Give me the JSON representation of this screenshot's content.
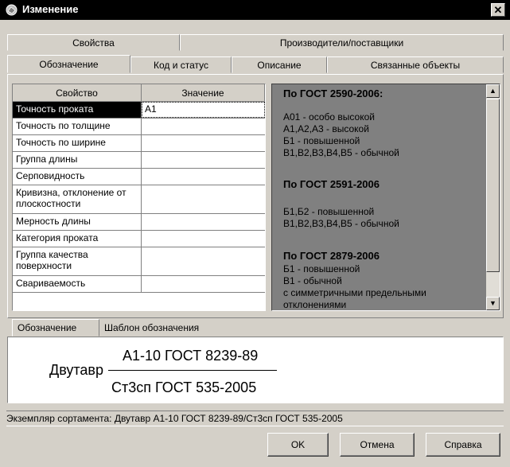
{
  "window": {
    "title": "Изменение",
    "close_glyph": "✕"
  },
  "tabs_row1": [
    "Свойства",
    "Производители/поставщики"
  ],
  "tabs_row2": [
    "Обозначение",
    "Код и статус",
    "Описание",
    "Связанные объекты"
  ],
  "table": {
    "headers": [
      "Свойство",
      "Значение"
    ],
    "rows": [
      {
        "name": "Точность проката",
        "value": "А1"
      },
      {
        "name": "Точность по толщине",
        "value": ""
      },
      {
        "name": "Точность по ширине",
        "value": ""
      },
      {
        "name": "Группа длины",
        "value": ""
      },
      {
        "name": "Серповидность",
        "value": ""
      },
      {
        "name": "Кривизна, отклонение от плоскостности",
        "value": ""
      },
      {
        "name": "Мерность длины",
        "value": ""
      },
      {
        "name": "Категория проката",
        "value": ""
      },
      {
        "name": "Группа качества поверхности",
        "value": ""
      },
      {
        "name": "Свариваемость",
        "value": ""
      }
    ]
  },
  "description": {
    "h1": "По ГОСТ 2590-2006:",
    "l1": "А01 - особо высокой",
    "l2": "А1,А2,А3 - высокой",
    "l3": "Б1 - повышенной",
    "l4": "В1,В2,В3,В4,В5 - обычной",
    "h2": "По ГОСТ 2591-2006",
    "l5": "Б1,Б2 - повышенной",
    "l6": "В1,В2,В3,В4,В5 - обычной",
    "h3": "По ГОСТ 2879-2006",
    "l7": "Б1 - повышенной",
    "l8": "В1 - обычной",
    "l9": "с симметричными предельными",
    "l10": "отклонениями"
  },
  "lower_tabs": [
    "Обозначение",
    "Шаблон обозначения"
  ],
  "designation": {
    "main": "Двутавр",
    "numerator": "А1-10 ГОСТ 8239-89",
    "denominator": "Ст3сп ГОСТ 535-2005"
  },
  "instance_text": "Экземпляр сортамента: Двутавр А1-10 ГОСТ 8239-89/Ст3сп ГОСТ 535-2005",
  "buttons": {
    "ok": "OK",
    "cancel": "Отмена",
    "help": "Справка"
  },
  "scroll": {
    "up": "▲",
    "down": "▼"
  }
}
